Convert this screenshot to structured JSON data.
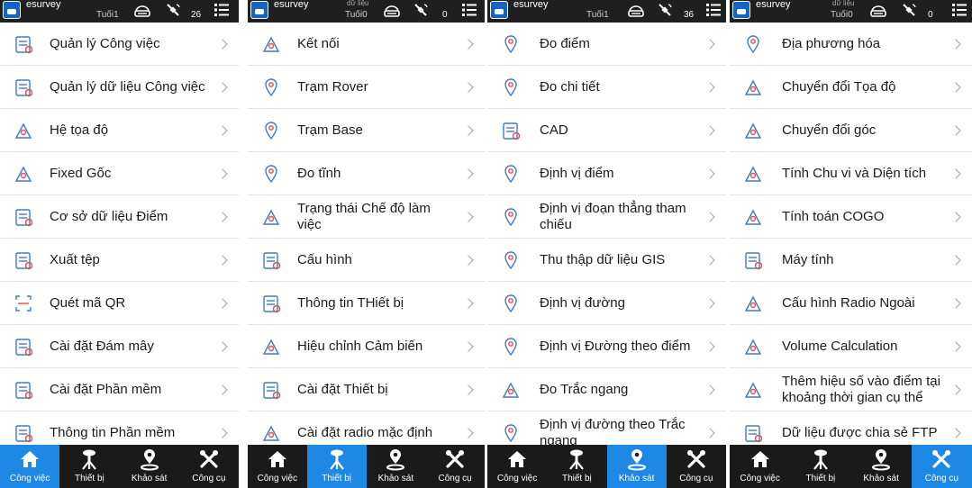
{
  "colors": {
    "accent": "#1e88e5",
    "icon_blue": "#3d7cc9",
    "icon_red": "#e0504a",
    "nav_bg": "#1a1a1a",
    "status_bg": "#1f1f1f"
  },
  "panels": [
    {
      "status": {
        "app": "esurvey",
        "mode": "Tuối1",
        "mode_top": "",
        "count": "26"
      },
      "items": [
        {
          "label": "Quản lý Công việc",
          "icon": "job-list-icon"
        },
        {
          "label": "Quản lý dữ liệu Công việc",
          "icon": "job-data-icon"
        },
        {
          "label": "Hệ tọa độ",
          "icon": "coordinate-system-icon"
        },
        {
          "label": "Fixed Gốc",
          "icon": "fixed-origin-icon"
        },
        {
          "label": "Cơ sở dữ liệu Điểm",
          "icon": "point-database-icon"
        },
        {
          "label": "Xuất tệp",
          "icon": "export-file-icon"
        },
        {
          "label": "Quét mã QR",
          "icon": "qr-scan-icon"
        },
        {
          "label": "Cài đặt Đám mây",
          "icon": "cloud-settings-icon"
        },
        {
          "label": "Cài đặt Phần mềm",
          "icon": "software-settings-icon"
        },
        {
          "label": "Thông tin Phần mềm",
          "icon": "software-info-icon"
        }
      ],
      "active_tab": 0
    },
    {
      "status": {
        "app": "esurvey",
        "mode": "Tuối0",
        "mode_top": "dữ liệu",
        "count": "0"
      },
      "items": [
        {
          "label": "Kết nối",
          "icon": "connect-icon"
        },
        {
          "label": "Trạm Rover",
          "icon": "rover-station-icon"
        },
        {
          "label": "Trạm Base",
          "icon": "base-station-icon"
        },
        {
          "label": "Đo tĩnh",
          "icon": "static-survey-icon"
        },
        {
          "label": "Trạng thái Chế độ làm việc",
          "icon": "work-mode-icon"
        },
        {
          "label": "Cấu hình",
          "icon": "configuration-icon"
        },
        {
          "label": "Thông tin THiết bị",
          "icon": "device-info-icon"
        },
        {
          "label": "Hiệu chỉnh Cảm biến",
          "icon": "sensor-calibration-icon"
        },
        {
          "label": "Cài đặt Thiết bị",
          "icon": "device-settings-icon"
        },
        {
          "label": "Cài đặt radio mặc định",
          "icon": "radio-default-icon"
        }
      ],
      "active_tab": 1
    },
    {
      "status": {
        "app": "esurvey",
        "mode": "Tuối1",
        "mode_top": "",
        "count": "36"
      },
      "items": [
        {
          "label": "Đo điểm",
          "icon": "point-survey-icon"
        },
        {
          "label": "Đo chi tiết",
          "icon": "detail-survey-icon"
        },
        {
          "label": "CAD",
          "icon": "cad-icon"
        },
        {
          "label": "Định vị điểm",
          "icon": "point-stakeout-icon"
        },
        {
          "label": "Định vị đoạn thẳng tham chiếu",
          "icon": "line-stakeout-icon"
        },
        {
          "label": "Thu thập dữ liệu GIS",
          "icon": "gis-collect-icon"
        },
        {
          "label": "Định vị đường",
          "icon": "road-stakeout-icon"
        },
        {
          "label": "Định vị Đường theo điểm",
          "icon": "road-by-point-icon"
        },
        {
          "label": "Đo Trắc ngang",
          "icon": "cross-section-icon"
        },
        {
          "label": "Định vị đường theo Trắc ngang",
          "icon": "road-cross-section-icon"
        }
      ],
      "active_tab": 2
    },
    {
      "status": {
        "app": "esurvey",
        "mode": "Tuối0",
        "mode_top": "dữ liệu",
        "count": "0"
      },
      "items": [
        {
          "label": "Địa phương hóa",
          "icon": "localization-icon"
        },
        {
          "label": "Chuyển đổi Tọa độ",
          "icon": "coordinate-convert-icon"
        },
        {
          "label": "Chuyển đổi góc",
          "icon": "angle-convert-icon"
        },
        {
          "label": "Tính Chu vi và Diện tích",
          "icon": "area-perimeter-icon"
        },
        {
          "label": "Tính toán COGO",
          "icon": "cogo-icon"
        },
        {
          "label": "Máy tính",
          "icon": "calculator-icon"
        },
        {
          "label": "Cấu hình Radio Ngoài",
          "icon": "external-radio-icon"
        },
        {
          "label": "Volume Calculation",
          "icon": "volume-icon"
        },
        {
          "label": "Thêm hiệu số vào điểm tại khoảng thời gian cụ thể",
          "icon": "time-offset-icon"
        },
        {
          "label": "Dữ liệu được chia sẻ FTP",
          "icon": "ftp-share-icon"
        }
      ],
      "active_tab": 3
    }
  ],
  "tabs": [
    {
      "label": "Công việc",
      "icon": "home-icon"
    },
    {
      "label": "Thiết bị",
      "icon": "device-icon"
    },
    {
      "label": "Khảo sát",
      "icon": "survey-pin-icon"
    },
    {
      "label": "Công cụ",
      "icon": "tools-icon"
    }
  ]
}
